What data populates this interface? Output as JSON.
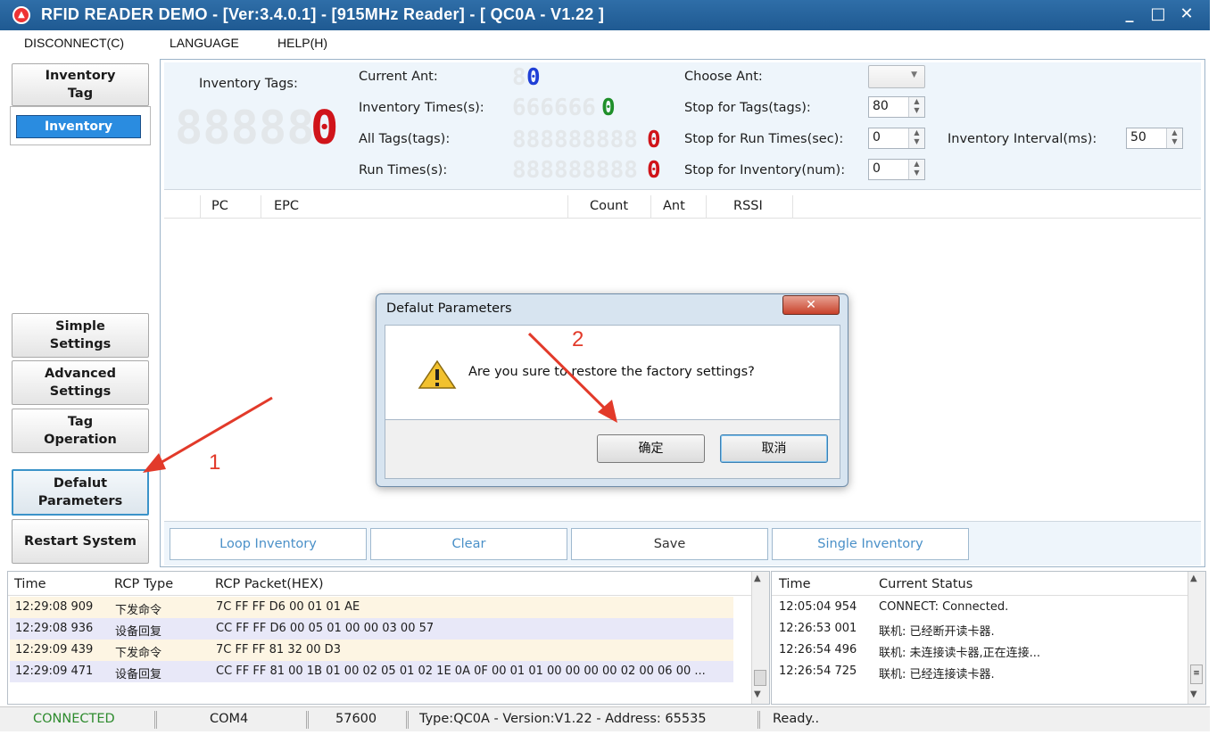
{
  "window": {
    "title": "RFID READER DEMO - [Ver:3.4.0.1] - [915MHz Reader] - [ QC0A - V1.22 ]",
    "minimize": "_",
    "maximize": "□",
    "close": "✕"
  },
  "menu": [
    "DISCONNECT(C)",
    "LANGUAGE",
    "HELP(H)"
  ],
  "nav": {
    "inventory_tag": "Inventory Tag",
    "inventory": "Inventory",
    "simple_settings": "Simple Settings",
    "advanced_settings": "Advanced Settings",
    "tag_operation": "Tag Operation",
    "default_parameters": "Defalut Parameters",
    "restart_system": "Restart System"
  },
  "params": {
    "inventory_tags_label": "Inventory Tags:",
    "inventory_tags_value": "0",
    "current_ant_label": "Current Ant:",
    "current_ant_value": "0",
    "inventory_times_label": "Inventory Times(s):",
    "inventory_times_value": "0",
    "all_tags_label": "All Tags(tags):",
    "all_tags_value": "0",
    "run_times_label": "Run Times(s):",
    "run_times_value": "0",
    "choose_ant_label": "Choose Ant:",
    "stop_tags_label": "Stop for Tags(tags):",
    "stop_tags_value": "80",
    "stop_run_label": "Stop for Run Times(sec):",
    "stop_run_value": "0",
    "stop_inventory_label": "Stop for Inventory(num):",
    "stop_inventory_value": "0",
    "interval_label": "Inventory Interval(ms):",
    "interval_value": "50"
  },
  "colors": {
    "seg_blue": "#1f3fd6",
    "seg_green": "#1f8f2a",
    "seg_red": "#d0141a",
    "connected": "#2e8b2e"
  },
  "table_columns": [
    "PC",
    "EPC",
    "Count",
    "Ant",
    "RSSI"
  ],
  "actions": [
    "Loop Inventory",
    "Clear",
    "Save",
    "Single Inventory"
  ],
  "log": {
    "columns": [
      "Time",
      "RCP Type",
      "RCP Packet(HEX)"
    ],
    "rows": [
      {
        "time": "12:29:08 909",
        "type": "下发命令",
        "packet": "7C FF FF D6 00 01 01 AE"
      },
      {
        "time": "12:29:08 936",
        "type": "设备回复",
        "packet": "CC FF FF D6 00 05 01 00 00 03 00 57"
      },
      {
        "time": "12:29:09 439",
        "type": "下发命令",
        "packet": "7C FF FF 81 32 00 D3"
      },
      {
        "time": "12:29:09 471",
        "type": "设备回复",
        "packet": "CC FF FF 81 00 1B 01 00 02 05 01 02 1E 0A 0F 00 01 01 00 00 00 00 02 00 06 00 ..."
      }
    ]
  },
  "status_log": {
    "columns": [
      "Time",
      "Current Status"
    ],
    "rows": [
      {
        "time": "12:05:04 954",
        "status": "CONNECT: Connected."
      },
      {
        "time": "12:26:53 001",
        "status": "联机: 已经断开读卡器."
      },
      {
        "time": "12:26:54 496",
        "status": "联机: 未连接读卡器,正在连接..."
      },
      {
        "time": "12:26:54 725",
        "status": "联机: 已经连接读卡器."
      }
    ]
  },
  "statusbar": {
    "connection": "CONNECTED",
    "port": "COM4",
    "baud": "57600",
    "info": "Type:QC0A - Version:V1.22 - Address: 65535",
    "state": "Ready.."
  },
  "dialog": {
    "title": "Defalut Parameters",
    "close": "✕",
    "message": "Are you sure to restore the factory settings?",
    "ok": "确定",
    "cancel": "取消"
  },
  "annotations": {
    "step1": "1",
    "step2": "2"
  }
}
